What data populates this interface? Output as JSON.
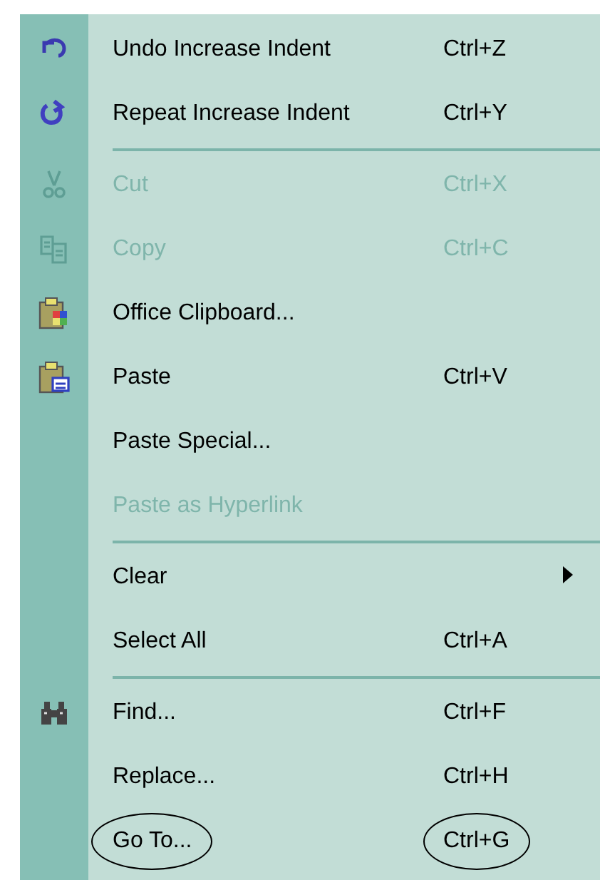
{
  "menu": {
    "items": [
      {
        "kind": "item",
        "label": "Undo Increase Indent",
        "shortcut": "Ctrl+Z",
        "disabled": false,
        "submenu": false,
        "circled": false
      },
      {
        "kind": "item",
        "label": "Repeat Increase Indent",
        "shortcut": "Ctrl+Y",
        "disabled": false,
        "submenu": false,
        "circled": false
      },
      {
        "kind": "separator"
      },
      {
        "kind": "item",
        "label": "Cut",
        "shortcut": "Ctrl+X",
        "disabled": true,
        "submenu": false,
        "circled": false
      },
      {
        "kind": "item",
        "label": "Copy",
        "shortcut": "Ctrl+C",
        "disabled": true,
        "submenu": false,
        "circled": false
      },
      {
        "kind": "item",
        "label": "Office Clipboard...",
        "disabled": false,
        "submenu": false,
        "circled": false
      },
      {
        "kind": "item",
        "label": "Paste",
        "shortcut": "Ctrl+V",
        "disabled": false,
        "submenu": false,
        "circled": false
      },
      {
        "kind": "item",
        "label": "Paste Special...",
        "disabled": false,
        "submenu": false,
        "circled": false
      },
      {
        "kind": "item",
        "label": "Paste as Hyperlink",
        "disabled": true,
        "submenu": false,
        "circled": false
      },
      {
        "kind": "separator"
      },
      {
        "kind": "item",
        "label": "Clear",
        "disabled": false,
        "submenu": true,
        "circled": false
      },
      {
        "kind": "item",
        "label": "Select All",
        "shortcut": "Ctrl+A",
        "disabled": false,
        "submenu": false,
        "circled": false
      },
      {
        "kind": "separator"
      },
      {
        "kind": "item",
        "label": "Find...",
        "shortcut": "Ctrl+F",
        "disabled": false,
        "submenu": false,
        "circled": false
      },
      {
        "kind": "item",
        "label": "Replace...",
        "shortcut": "Ctrl+H",
        "disabled": false,
        "submenu": false,
        "circled": false
      },
      {
        "kind": "item",
        "label": "Go To...",
        "shortcut": "Ctrl+G",
        "disabled": false,
        "submenu": false,
        "circled": true
      }
    ]
  }
}
